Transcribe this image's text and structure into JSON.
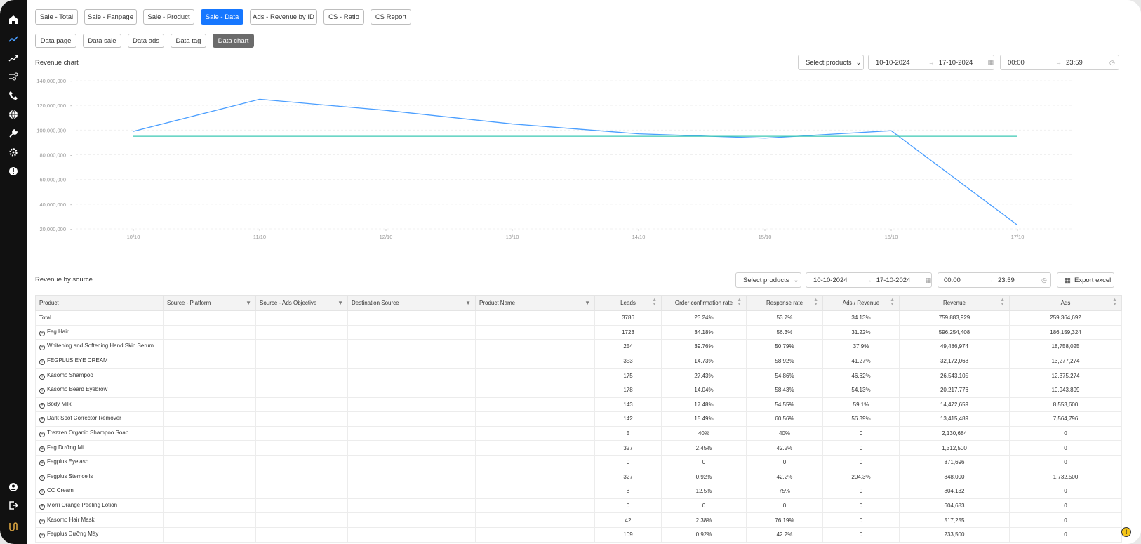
{
  "top_tabs": [
    "Sale - Total",
    "Sale - Fanpage",
    "Sale - Product",
    "Sale - Data",
    "Ads - Revenue by ID",
    "CS - Ratio",
    "CS Report"
  ],
  "active_top_tab": "Sale - Data",
  "sub_tabs": [
    "Data page",
    "Data sale",
    "Data ads",
    "Data tag",
    "Data chart"
  ],
  "active_sub_tab": "Data chart",
  "chart_section": {
    "title": "Revenue chart",
    "select_products": "Select products",
    "date_from": "10-10-2024",
    "date_to": "17-10-2024",
    "time_from": "00:00",
    "time_to": "23:59"
  },
  "chart_data": {
    "type": "line",
    "title": "",
    "xlabel": "",
    "ylabel": "",
    "x": [
      "10/10",
      "11/10",
      "12/10",
      "13/10",
      "14/10",
      "15/10",
      "16/10",
      "17/10"
    ],
    "y_ticks": [
      "20,000,000",
      "40,000,000",
      "60,000,000",
      "80,000,000",
      "100,000,000",
      "120,000,000",
      "140,000,000"
    ],
    "ylim": [
      20000000,
      140000000
    ],
    "series": [
      {
        "values": [
          99000000,
          125000000,
          116000000,
          105000000,
          97000000,
          93500000,
          99500000,
          23000000
        ],
        "color": "#4a9eff"
      },
      {
        "values": [
          95000000,
          95000000,
          95000000,
          95000000,
          95000000,
          95000000,
          95000000,
          95000000
        ],
        "color": "#3cc8b4"
      }
    ],
    "grid": true
  },
  "source_section": {
    "title": "Revenue by source",
    "select_products": "Select products",
    "date_from": "10-10-2024",
    "date_to": "17-10-2024",
    "time_from": "00:00",
    "time_to": "23:59",
    "export_label": "Export excel"
  },
  "table": {
    "columns": [
      "Product",
      "Source - Platform",
      "Source - Ads Objective",
      "Destination Source",
      "Product Name",
      "Leads",
      "Order confirmation rate",
      "Response rate",
      "Ads / Revenue",
      "Revenue",
      "Ads"
    ],
    "rows": [
      [
        "Total",
        "",
        "",
        "",
        "",
        "3786",
        "23.24%",
        "53.7%",
        "34.13%",
        "759,883,929",
        "259,364,692"
      ],
      [
        "Feg Hair",
        "",
        "",
        "",
        "",
        "1723",
        "34.18%",
        "56.3%",
        "31.22%",
        "596,254,408",
        "186,159,324"
      ],
      [
        "Whitening and Softening Hand Skin Serum",
        "",
        "",
        "",
        "",
        "254",
        "39.76%",
        "50.79%",
        "37.9%",
        "49,486,974",
        "18,758,025"
      ],
      [
        "FEGPLUS EYE CREAM",
        "",
        "",
        "",
        "",
        "353",
        "14.73%",
        "58.92%",
        "41.27%",
        "32,172,068",
        "13,277,274"
      ],
      [
        "Kasomo Shampoo",
        "",
        "",
        "",
        "",
        "175",
        "27.43%",
        "54.86%",
        "46.62%",
        "26,543,105",
        "12,375,274"
      ],
      [
        "Kasomo Beard Eyebrow",
        "",
        "",
        "",
        "",
        "178",
        "14.04%",
        "58.43%",
        "54.13%",
        "20,217,776",
        "10,943,899"
      ],
      [
        "Body Milk",
        "",
        "",
        "",
        "",
        "143",
        "17.48%",
        "54.55%",
        "59.1%",
        "14,472,659",
        "8,553,600"
      ],
      [
        "Dark Spot Corrector Remover",
        "",
        "",
        "",
        "",
        "142",
        "15.49%",
        "60.56%",
        "56.39%",
        "13,415,489",
        "7,564,796"
      ],
      [
        "Trezzen Organic Shampoo Soap",
        "",
        "",
        "",
        "",
        "5",
        "40%",
        "40%",
        "0",
        "2,130,684",
        "0"
      ],
      [
        "Feg Dưỡng Mi",
        "",
        "",
        "",
        "",
        "327",
        "2.45%",
        "42.2%",
        "0",
        "1,312,500",
        "0"
      ],
      [
        "Fegplus Eyelash",
        "",
        "",
        "",
        "",
        "0",
        "0",
        "0",
        "0",
        "871,696",
        "0"
      ],
      [
        "Fegplus Stemcells",
        "",
        "",
        "",
        "",
        "327",
        "0.92%",
        "42.2%",
        "204.3%",
        "848,000",
        "1,732,500"
      ],
      [
        "CC Cream",
        "",
        "",
        "",
        "",
        "8",
        "12.5%",
        "75%",
        "0",
        "804,132",
        "0"
      ],
      [
        "Morri Orange Peeling Lotion",
        "",
        "",
        "",
        "",
        "0",
        "0",
        "0",
        "0",
        "604,683",
        "0"
      ],
      [
        "Kasomo Hair Mask",
        "",
        "",
        "",
        "",
        "42",
        "2.38%",
        "76.19%",
        "0",
        "517,255",
        "0"
      ],
      [
        "Fegplus Dưỡng Mày",
        "",
        "",
        "",
        "",
        "109",
        "0.92%",
        "42.2%",
        "0",
        "233,500",
        "0"
      ]
    ]
  }
}
